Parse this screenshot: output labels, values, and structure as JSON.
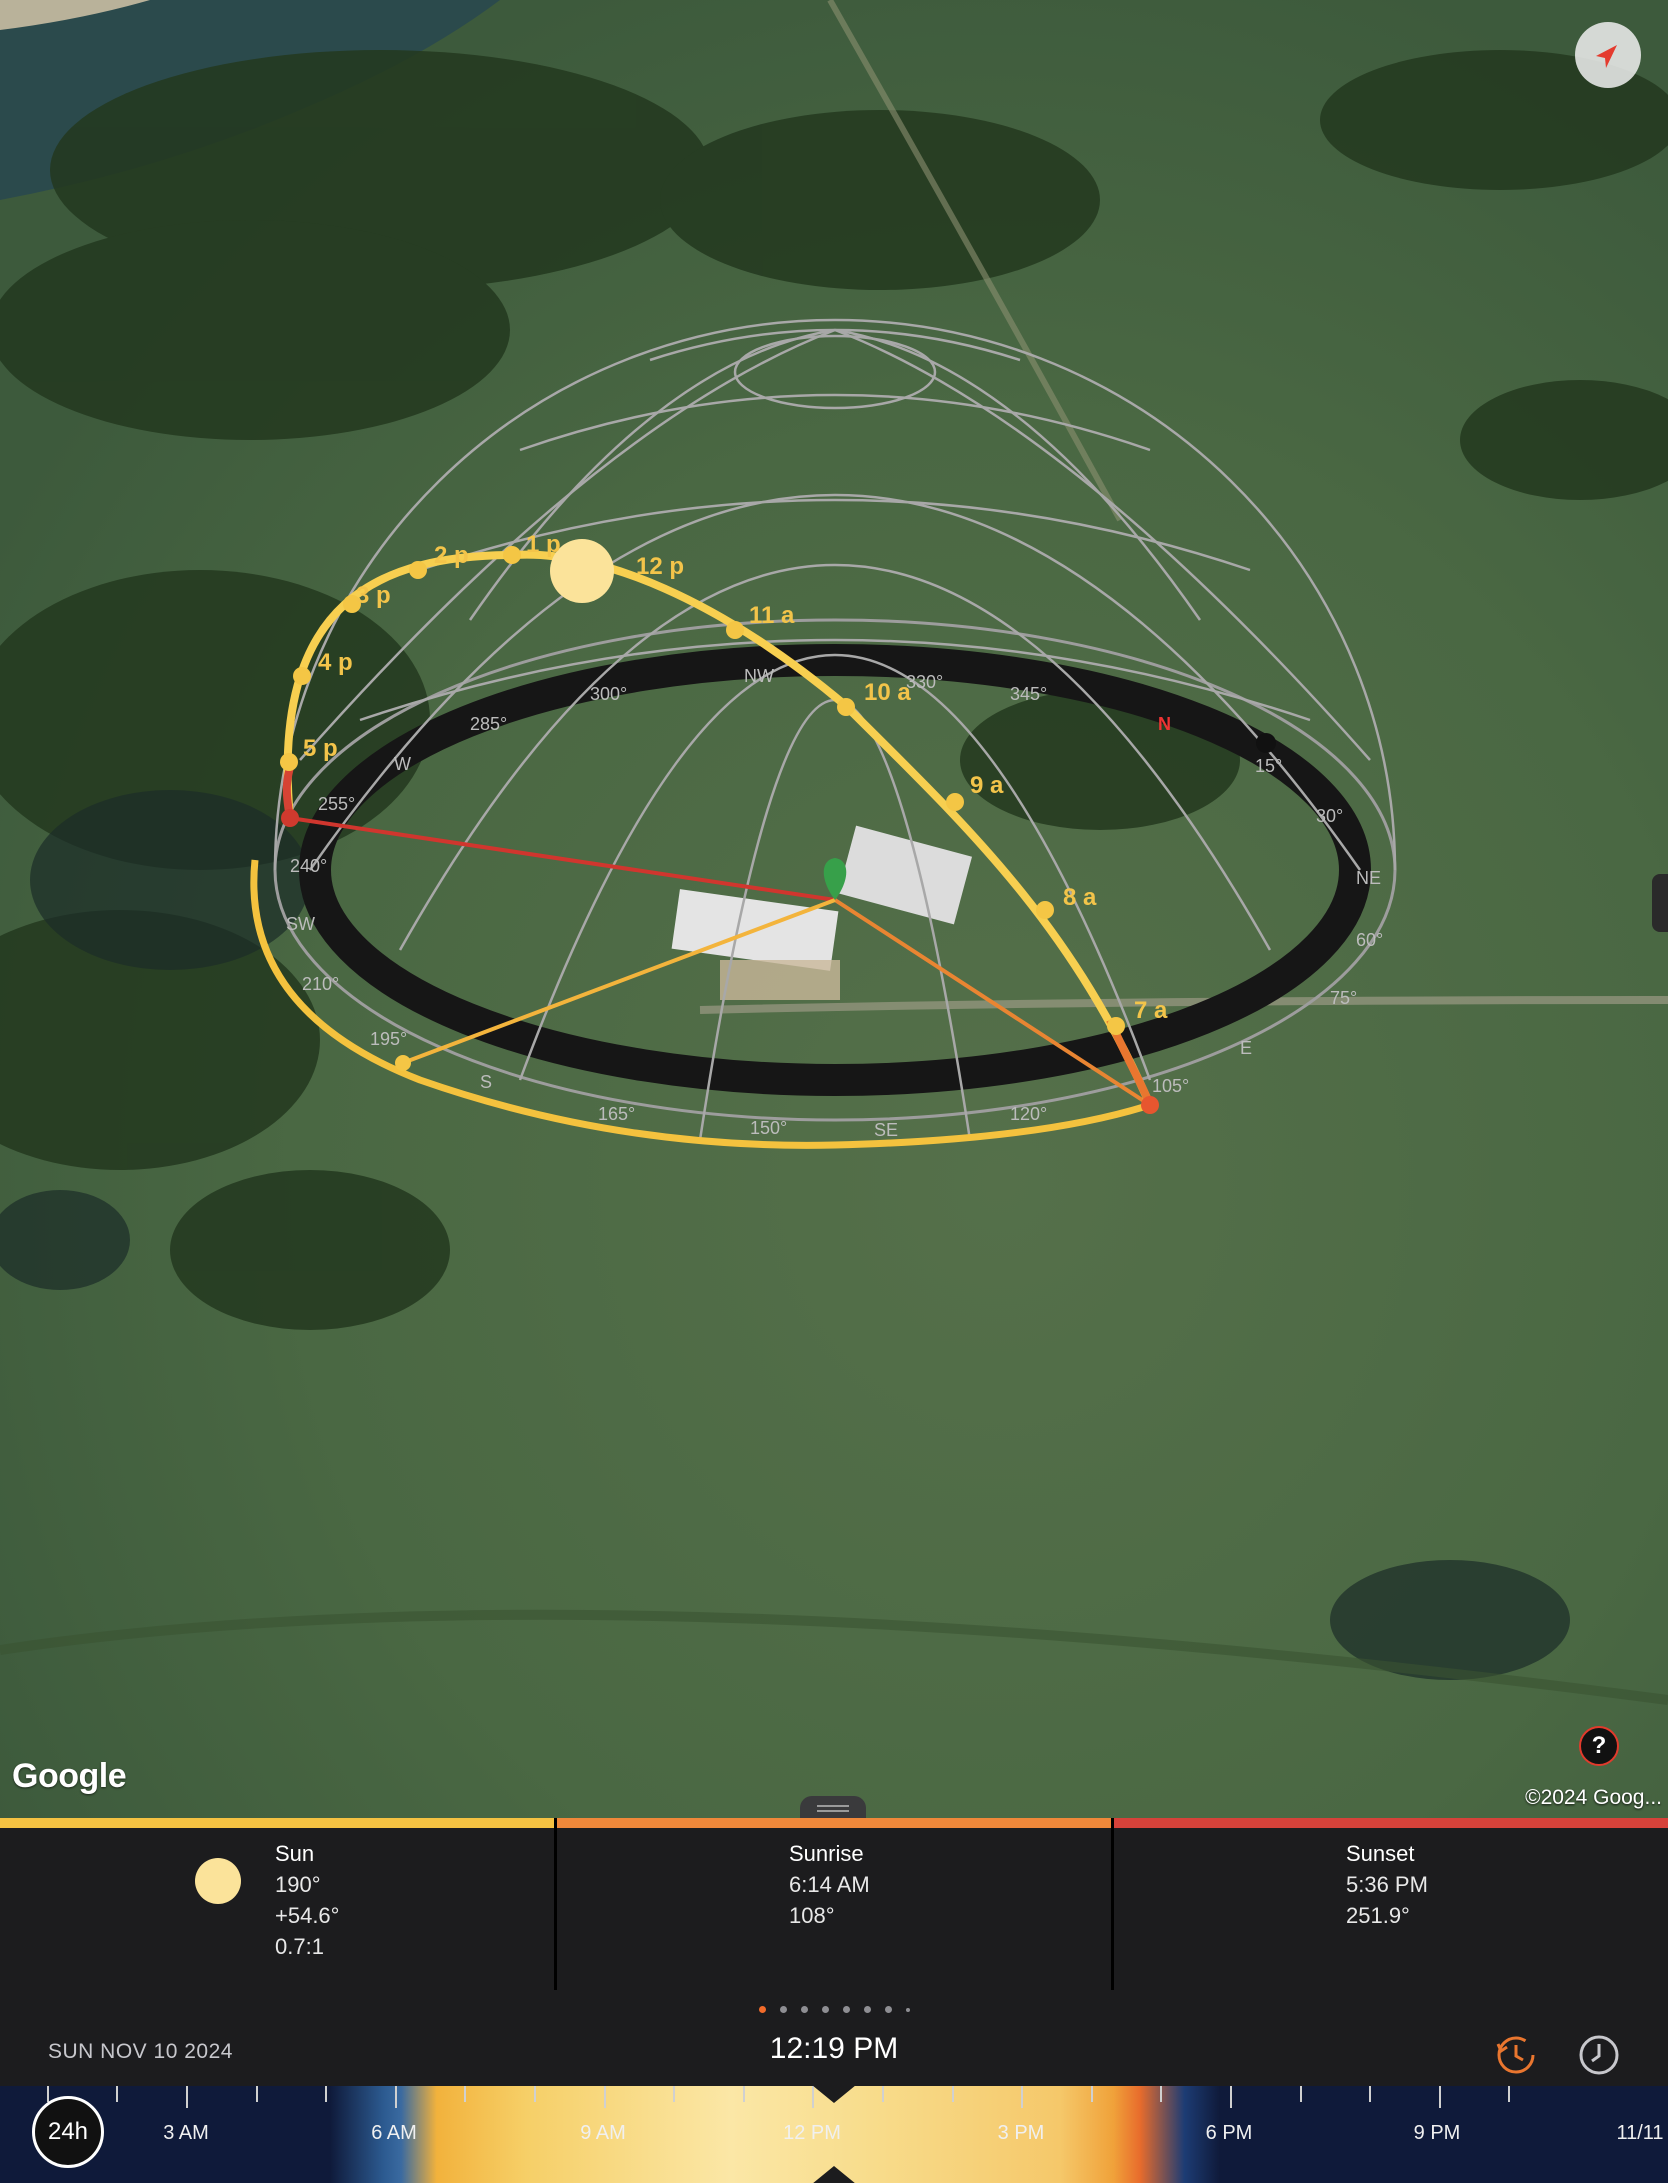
{
  "map": {
    "google_logo": "Google",
    "copyright": "©2024 Goog...",
    "help_label": "?",
    "hour_labels": [
      "7 a",
      "8 a",
      "9 a",
      "10 a",
      "11 a",
      "12 p",
      "1 p",
      "2 p",
      "3 p",
      "4 p",
      "5 p"
    ],
    "dial_labels": [
      "NW",
      "330°",
      "345°",
      "N",
      "15°",
      "30°",
      "NE",
      "60°",
      "75°",
      "E",
      "105°",
      "120°",
      "SE",
      "150°",
      "165°",
      "S",
      "195°",
      "210°",
      "SW",
      "240°",
      "255°",
      "W",
      "285°",
      "300°"
    ]
  },
  "panel": {
    "sun": {
      "title": "Sun",
      "azimuth": "190°",
      "elevation": "+54.6°",
      "shadow_ratio": "0.7:1",
      "color": "#f5c242"
    },
    "sunrise": {
      "title": "Sunrise",
      "time": "6:14 AM",
      "azimuth": "108°",
      "color": "#f0883a"
    },
    "sunset": {
      "title": "Sunset",
      "time": "5:36 PM",
      "azimuth": "251.9°",
      "color": "#d6423a"
    }
  },
  "controls": {
    "page_dots": 8,
    "active_dot": 0,
    "date": "SUN NOV 10 2024",
    "time": "12:19 PM"
  },
  "timeline": {
    "mode_label": "24h",
    "labels": [
      "3 AM",
      "6 AM",
      "9 AM",
      "12 PM",
      "3 PM",
      "6 PM",
      "9 PM",
      "11/11"
    ]
  }
}
